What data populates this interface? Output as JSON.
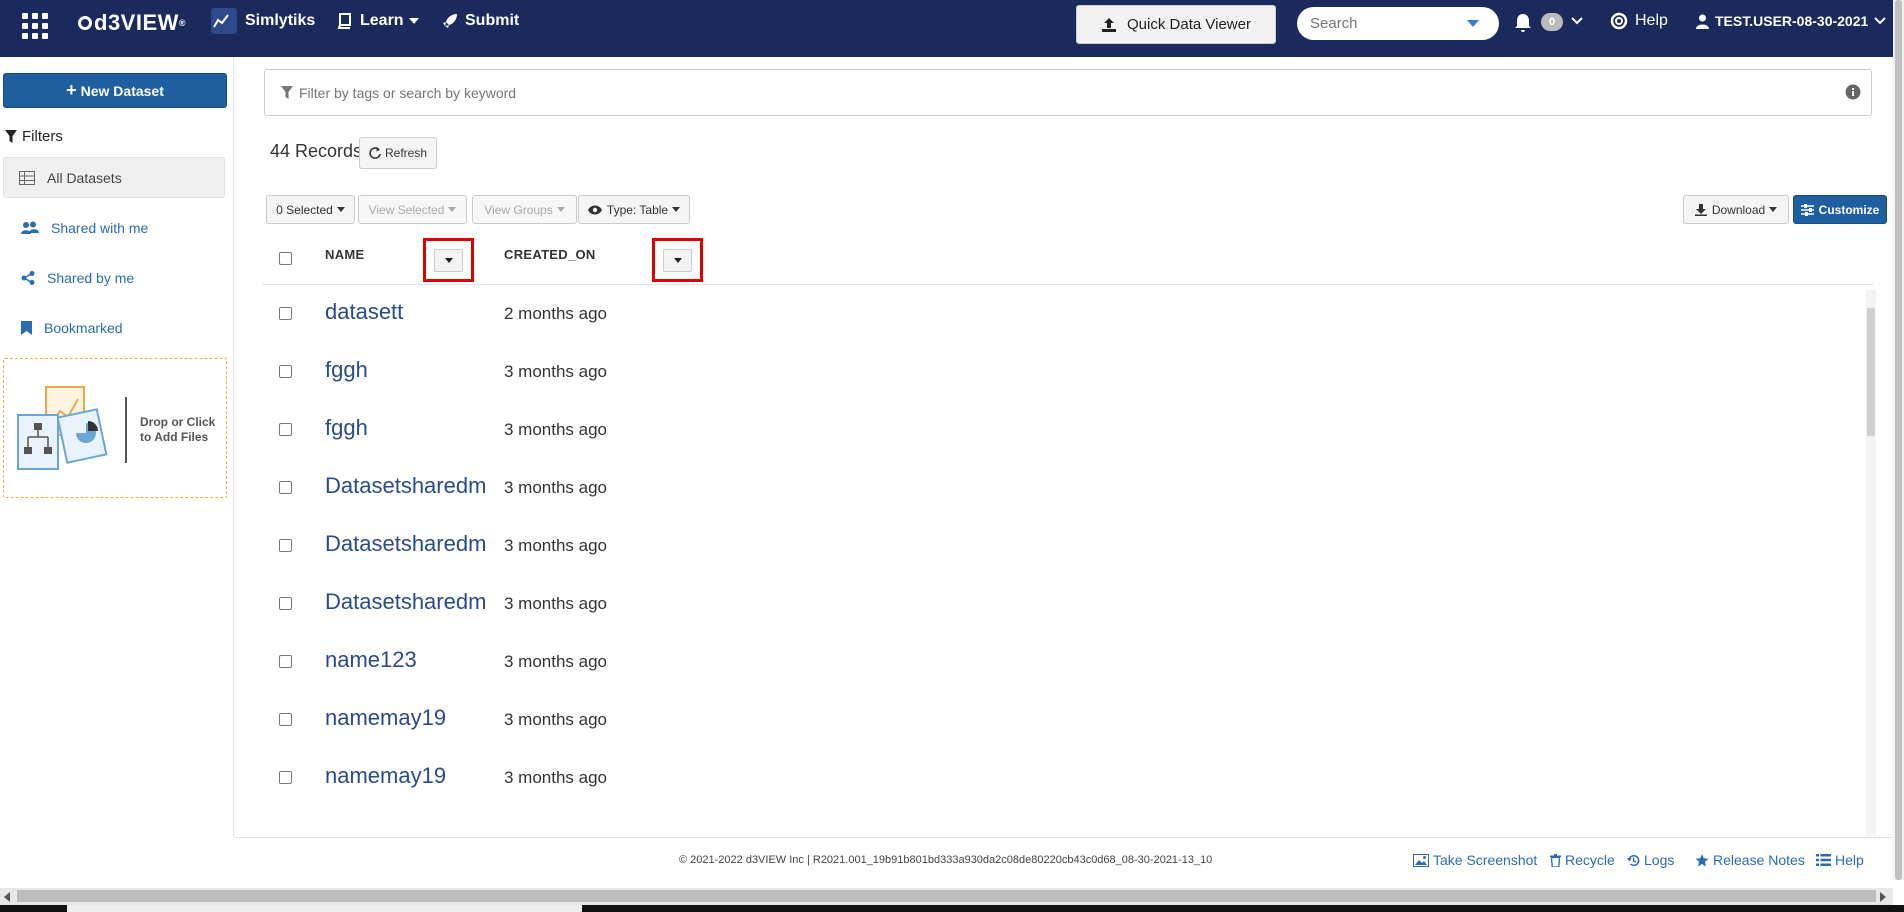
{
  "navbar": {
    "logo": "d3VIEW",
    "logo_mark": "®",
    "simlytiks": "Simlytiks",
    "learn": "Learn",
    "submit": "Submit",
    "quick_data_viewer": "Quick Data Viewer",
    "search_placeholder": "Search",
    "notification_count": "0",
    "help": "Help",
    "user": "TEST.USER-08-30-2021"
  },
  "sidebar": {
    "new_dataset": "New Dataset",
    "filters_title": "Filters",
    "items": [
      {
        "label": "All Datasets",
        "icon": "table-icon"
      },
      {
        "label": "Shared with me",
        "icon": "users-icon"
      },
      {
        "label": "Shared by me",
        "icon": "share-icon"
      },
      {
        "label": "Bookmarked",
        "icon": "bookmark-icon"
      }
    ],
    "dropzone_text_1": "Drop or Click",
    "dropzone_text_2": "to Add Files"
  },
  "main": {
    "filter_placeholder": "Filter by tags or search by keyword",
    "records": "44 Records",
    "refresh": "Refresh",
    "toolbar": {
      "selected": "0 Selected",
      "view_selected": "View Selected",
      "view_groups": "View Groups",
      "type": "Type: Table",
      "download": "Download",
      "customize": "Customize"
    },
    "columns": [
      "NAME",
      "CREATED_ON"
    ],
    "rows": [
      {
        "name": "datasett",
        "created_on": "2 months ago"
      },
      {
        "name": "fggh",
        "created_on": "3 months ago"
      },
      {
        "name": "fggh",
        "created_on": "3 months ago"
      },
      {
        "name": "Datasetsharedm",
        "created_on": "3 months ago"
      },
      {
        "name": "Datasetsharedm",
        "created_on": "3 months ago"
      },
      {
        "name": "Datasetsharedm",
        "created_on": "3 months ago"
      },
      {
        "name": "name123",
        "created_on": "3 months ago"
      },
      {
        "name": "namemay19",
        "created_on": "3 months ago"
      },
      {
        "name": "namemay19",
        "created_on": "3 months ago"
      }
    ]
  },
  "footer": {
    "copyright": "© 2021-2022 d3VIEW Inc | R2021.001_19b91b801bd333a930da2c08de80220cb43c0d68_08-30-2021-13_10",
    "take_screenshot": "Take Screenshot",
    "recycle": "Recycle",
    "logs": "Logs",
    "release_notes": "Release Notes",
    "help": "Help"
  },
  "colors": {
    "navbar": "#1b2a5c",
    "primary_button": "#1f5fa0",
    "link": "#2b6cb0",
    "highlight_box": "#e00000"
  }
}
